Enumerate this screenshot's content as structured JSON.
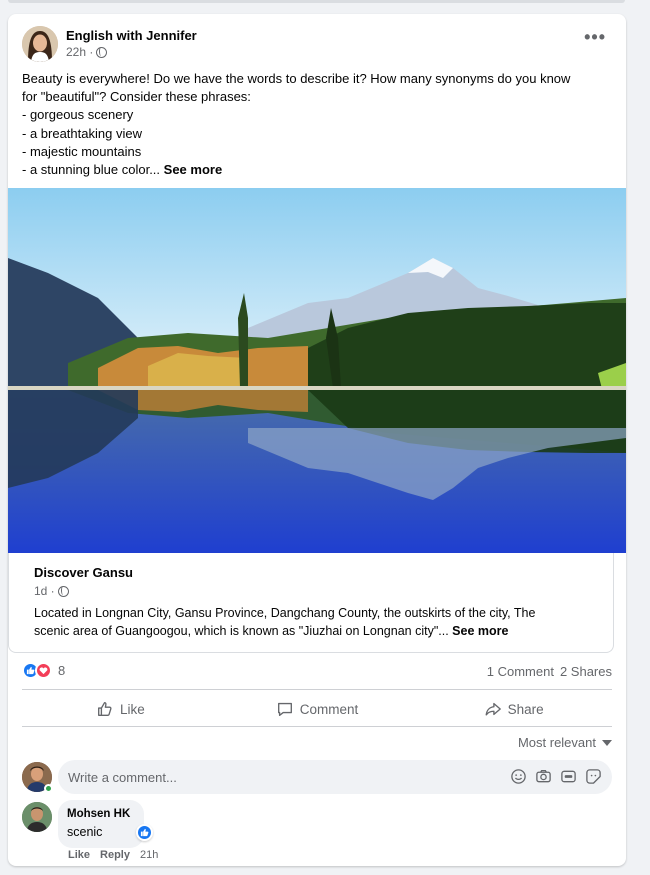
{
  "post": {
    "author": "English with Jennifer",
    "time": "22h ·",
    "more_label": "•••",
    "text_lines": [
      "Beauty is everywhere! Do we have the words to describe it? How many synonyms do you know",
      "for \"beautiful\"? Consider these phrases:",
      "- gorgeous scenery",
      "- a breathtaking view",
      "- majestic mountains"
    ],
    "last_line": "- a stunning blue color...",
    "see_more": "See more"
  },
  "link": {
    "title": "Discover Gansu",
    "time": "1d ·",
    "desc_line1": "Located in Longnan City, Gansu Province, Dangchang County, the outskirts of the city, The",
    "desc_line2": "scenic area of Guangoogou, which is known as \"Jiuzhai on Longnan city\"...",
    "see_more": "See more"
  },
  "stats": {
    "reaction_count": "8",
    "comments": "1 Comment",
    "shares": "2 Shares"
  },
  "actions": {
    "like": "Like",
    "comment": "Comment",
    "share": "Share"
  },
  "comments": {
    "sort_label": "Most relevant",
    "input_placeholder": "Write a comment...",
    "items": [
      {
        "name": "Mohsen HK",
        "text": "scenic",
        "like": "Like",
        "reply": "Reply",
        "time": "21h"
      }
    ]
  },
  "colors": {
    "accent": "#1877f2",
    "love": "#f33e58",
    "secondary_text": "#65676b"
  }
}
